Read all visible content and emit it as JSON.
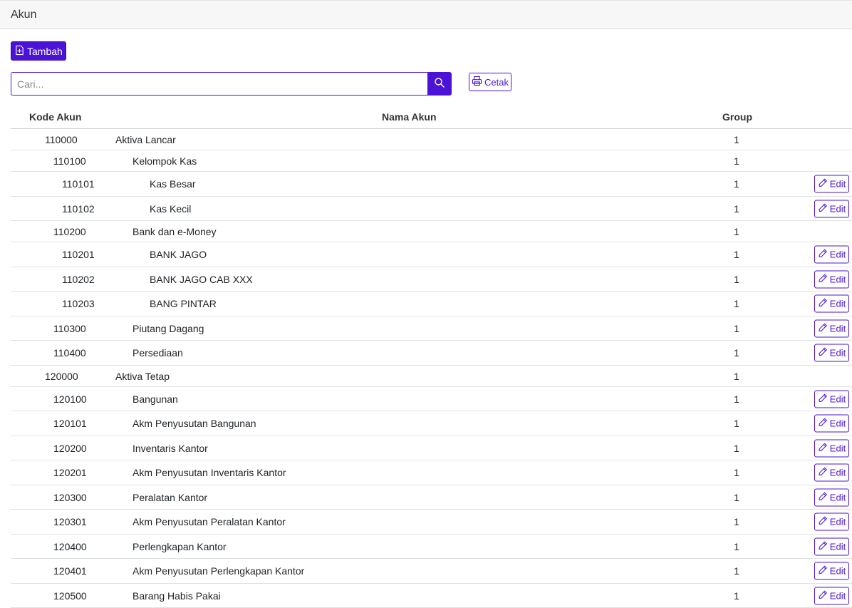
{
  "page": {
    "title": "Akun"
  },
  "toolbar": {
    "add_label": "Tambah",
    "print_label": "Cetak"
  },
  "search": {
    "placeholder": "Cari..."
  },
  "table": {
    "headers": {
      "kode": "Kode Akun",
      "nama": "Nama Akun",
      "group": "Group"
    },
    "edit_label": "Edit",
    "rows": [
      {
        "kode": "110000",
        "nama": "Aktiva Lancar",
        "group": "1",
        "level": 0,
        "editable": false
      },
      {
        "kode": "110100",
        "nama": "Kelompok Kas",
        "group": "1",
        "level": 1,
        "editable": false
      },
      {
        "kode": "110101",
        "nama": "Kas Besar",
        "group": "1",
        "level": 2,
        "editable": true
      },
      {
        "kode": "110102",
        "nama": "Kas Kecil",
        "group": "1",
        "level": 2,
        "editable": true
      },
      {
        "kode": "110200",
        "nama": "Bank dan e-Money",
        "group": "1",
        "level": 1,
        "editable": false
      },
      {
        "kode": "110201",
        "nama": "BANK JAGO",
        "group": "1",
        "level": 2,
        "editable": true
      },
      {
        "kode": "110202",
        "nama": "BANK JAGO CAB XXX",
        "group": "1",
        "level": 2,
        "editable": true
      },
      {
        "kode": "110203",
        "nama": "BANG PINTAR",
        "group": "1",
        "level": 2,
        "editable": true
      },
      {
        "kode": "110300",
        "nama": "Piutang Dagang",
        "group": "1",
        "level": 1,
        "editable": true
      },
      {
        "kode": "110400",
        "nama": "Persediaan",
        "group": "1",
        "level": 1,
        "editable": true
      },
      {
        "kode": "120000",
        "nama": "Aktiva Tetap",
        "group": "1",
        "level": 0,
        "editable": false
      },
      {
        "kode": "120100",
        "nama": "Bangunan",
        "group": "1",
        "level": 1,
        "editable": true
      },
      {
        "kode": "120101",
        "nama": "Akm Penyusutan Bangunan",
        "group": "1",
        "level": 1,
        "editable": true
      },
      {
        "kode": "120200",
        "nama": "Inventaris Kantor",
        "group": "1",
        "level": 1,
        "editable": true
      },
      {
        "kode": "120201",
        "nama": "Akm Penyusutan Inventaris Kantor",
        "group": "1",
        "level": 1,
        "editable": true
      },
      {
        "kode": "120300",
        "nama": "Peralatan Kantor",
        "group": "1",
        "level": 1,
        "editable": true
      },
      {
        "kode": "120301",
        "nama": "Akm Penyusutan Peralatan Kantor",
        "group": "1",
        "level": 1,
        "editable": true
      },
      {
        "kode": "120400",
        "nama": "Perlengkapan Kantor",
        "group": "1",
        "level": 1,
        "editable": true
      },
      {
        "kode": "120401",
        "nama": "Akm Penyusutan Perlengkapan Kantor",
        "group": "1",
        "level": 1,
        "editable": true
      },
      {
        "kode": "120500",
        "nama": "Barang Habis Pakai",
        "group": "1",
        "level": 1,
        "editable": true
      }
    ]
  },
  "colors": {
    "accent": "#4b13d6"
  },
  "icons": {
    "add": "file-plus-icon",
    "search": "search-icon",
    "print": "printer-icon",
    "edit": "pencil-icon"
  }
}
